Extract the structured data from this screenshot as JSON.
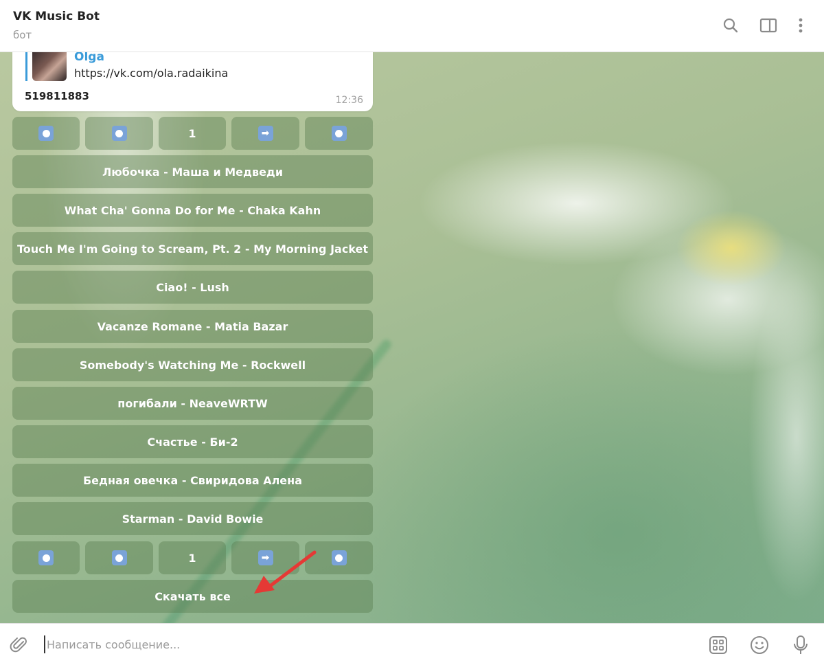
{
  "header": {
    "title": "VK Music Bot",
    "subtitle": "бот",
    "icons": [
      "search-icon",
      "sidebar-toggle-icon",
      "more-vert-icon"
    ]
  },
  "message": {
    "reply_name": "Olga",
    "reply_text": "https://vk.com/ola.radaikina",
    "text": "519811883",
    "time": "12:36"
  },
  "keyboard": {
    "nav_top": {
      "first": "stop-button-emoji",
      "prev": "stop-button-emoji",
      "page": "1",
      "next": "right-arrow-emoji",
      "last": "stop-button-emoji",
      "next_glyph": "➡"
    },
    "tracks": [
      "Любочка - Маша и Медведи",
      "What Cha' Gonna Do for Me - Chaka Kahn",
      "Touch Me I'm Going to Scream, Pt. 2 - My Morning Jacket",
      "Ciao! - Lush",
      "Vacanze Romane - Matia Bazar",
      "Somebody's Watching Me - Rockwell",
      "погибали - NeaveWRTW",
      "Счастье - Би-2",
      "Бедная овечка - Свиридова Алена",
      "Starman - David Bowie"
    ],
    "nav_bottom": {
      "page": "1",
      "next_glyph": "➡"
    },
    "download_all": "Скачать все"
  },
  "composer": {
    "placeholder": "Написать сообщение...",
    "value": "",
    "icons": [
      "attach-icon",
      "bot-commands-icon",
      "emoji-icon",
      "microphone-icon"
    ]
  },
  "colors": {
    "accent": "#3a9bd9",
    "annotation_arrow": "#e53935",
    "keyboard_button": "rgba(88,125,78,0.42)"
  }
}
